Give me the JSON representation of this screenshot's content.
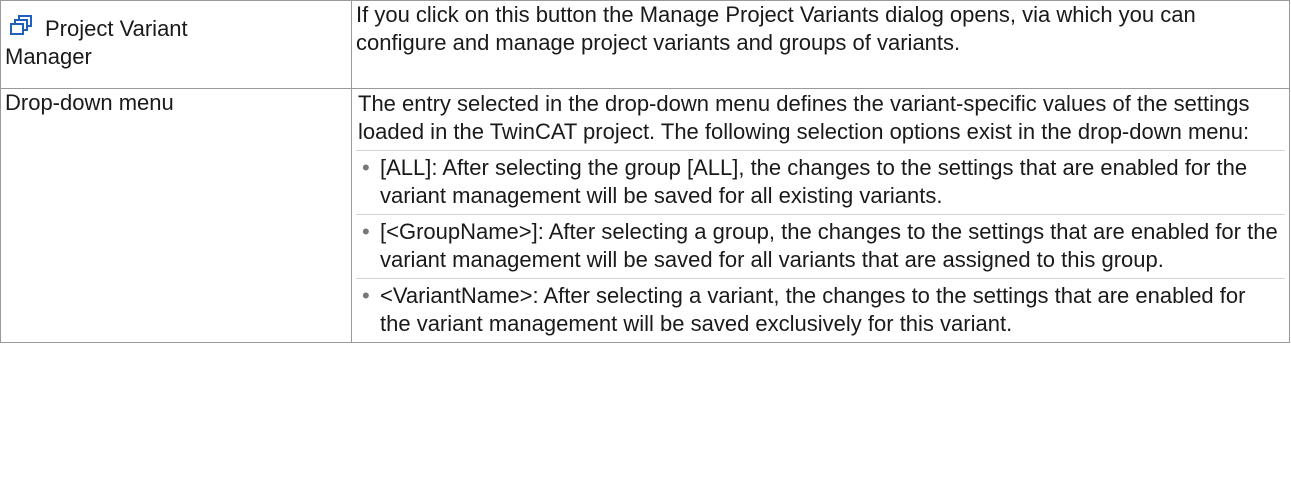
{
  "rows": [
    {
      "left": {
        "icon": "project-variants-icon",
        "label_line1": "Project Variant",
        "label_line2": "Manager"
      },
      "right": {
        "text": "If you click on this button the Manage Project Variants dialog opens, via which you can configure and manage project variants and groups of variants."
      }
    },
    {
      "left": {
        "label": "Drop-down menu"
      },
      "right": {
        "intro": "The entry selected in the drop-down menu defines the variant-specific values of the settings loaded in the TwinCAT project. The following selection options exist in the drop-down menu:",
        "options": [
          "[ALL]: After selecting the group [ALL], the changes to the settings that are enabled for the variant management will be saved for all existing variants.",
          "[<GroupName>]: After selecting a group, the changes to the settings that are enabled for the variant management will be saved for all variants that are assigned to this group.",
          "<VariantName>: After selecting a variant, the changes to the settings that are enabled for the variant management will be saved exclusively for this variant."
        ]
      }
    }
  ],
  "style": {
    "border_color": "#9a9a9a",
    "icon_color": "#1f5fbf"
  }
}
